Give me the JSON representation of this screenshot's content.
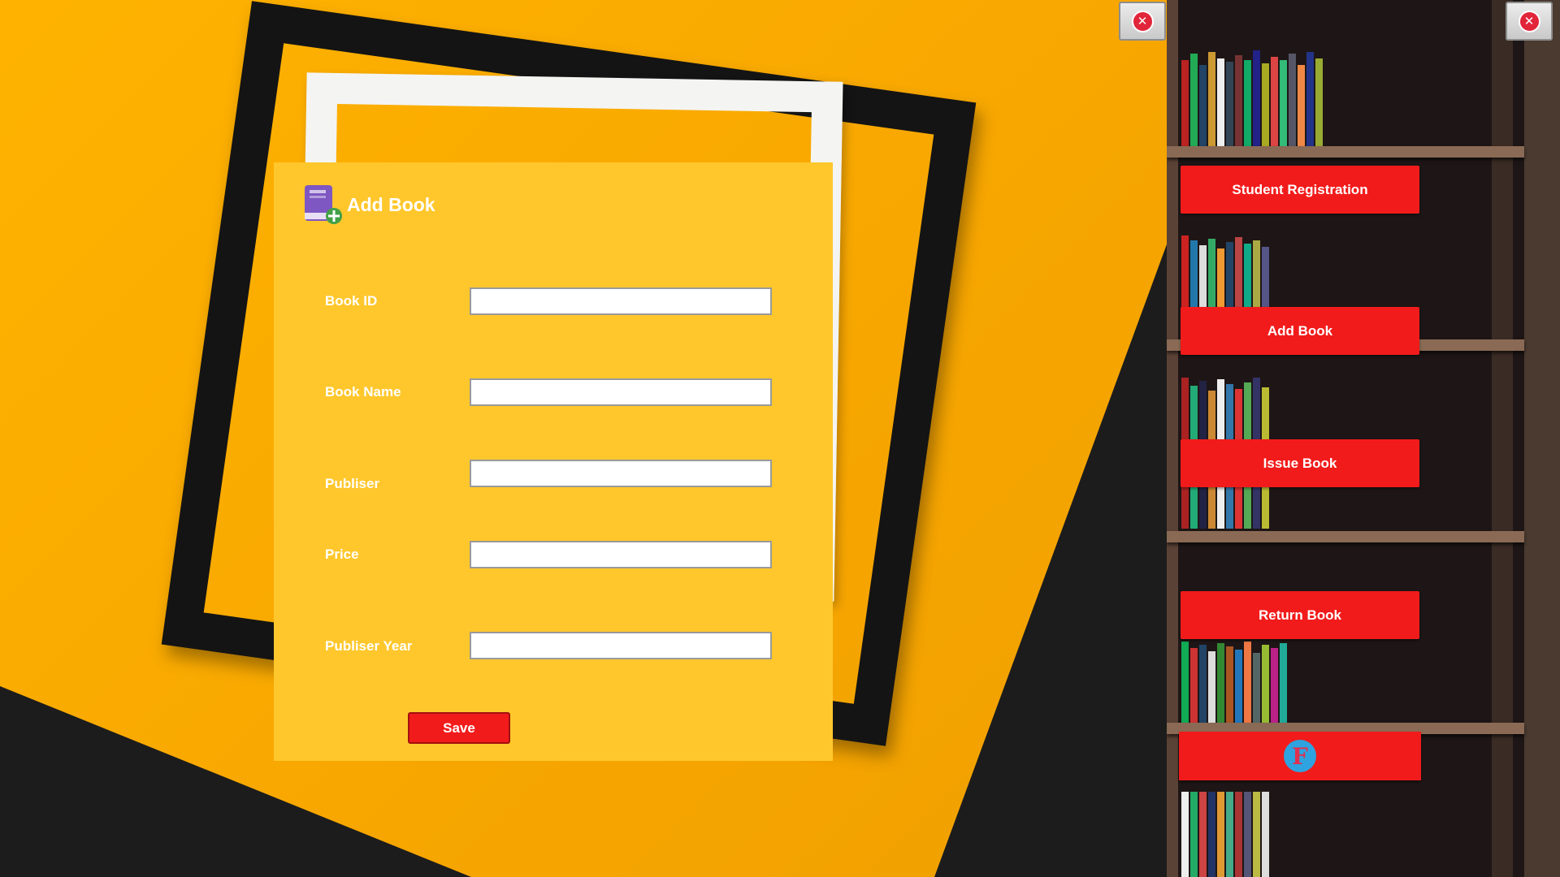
{
  "form": {
    "title": "Add Book",
    "fields": [
      {
        "label": "Book ID",
        "value": "",
        "placeholder": ""
      },
      {
        "label": "Book Name",
        "value": "",
        "placeholder": ""
      },
      {
        "label": "Publiser",
        "value": "",
        "placeholder": ""
      },
      {
        "label": "Price",
        "value": "",
        "placeholder": ""
      },
      {
        "label": "Publiser Year",
        "value": "",
        "placeholder": ""
      }
    ],
    "save_label": "Save"
  },
  "sidebar": {
    "buttons": [
      {
        "label": "Student Registration"
      },
      {
        "label": "Add Book"
      },
      {
        "label": "Issue Book"
      },
      {
        "label": "Return Book"
      }
    ],
    "logo_letter": "F"
  },
  "window_controls": {
    "close_symbol": "✕",
    "icon": "close-icon"
  },
  "colors": {
    "panel": "#ffc72c",
    "button_red": "#f21b1b",
    "background_orange": "#ffb300",
    "close_red": "#e1253a",
    "logo_blue": "#2ea3df"
  }
}
